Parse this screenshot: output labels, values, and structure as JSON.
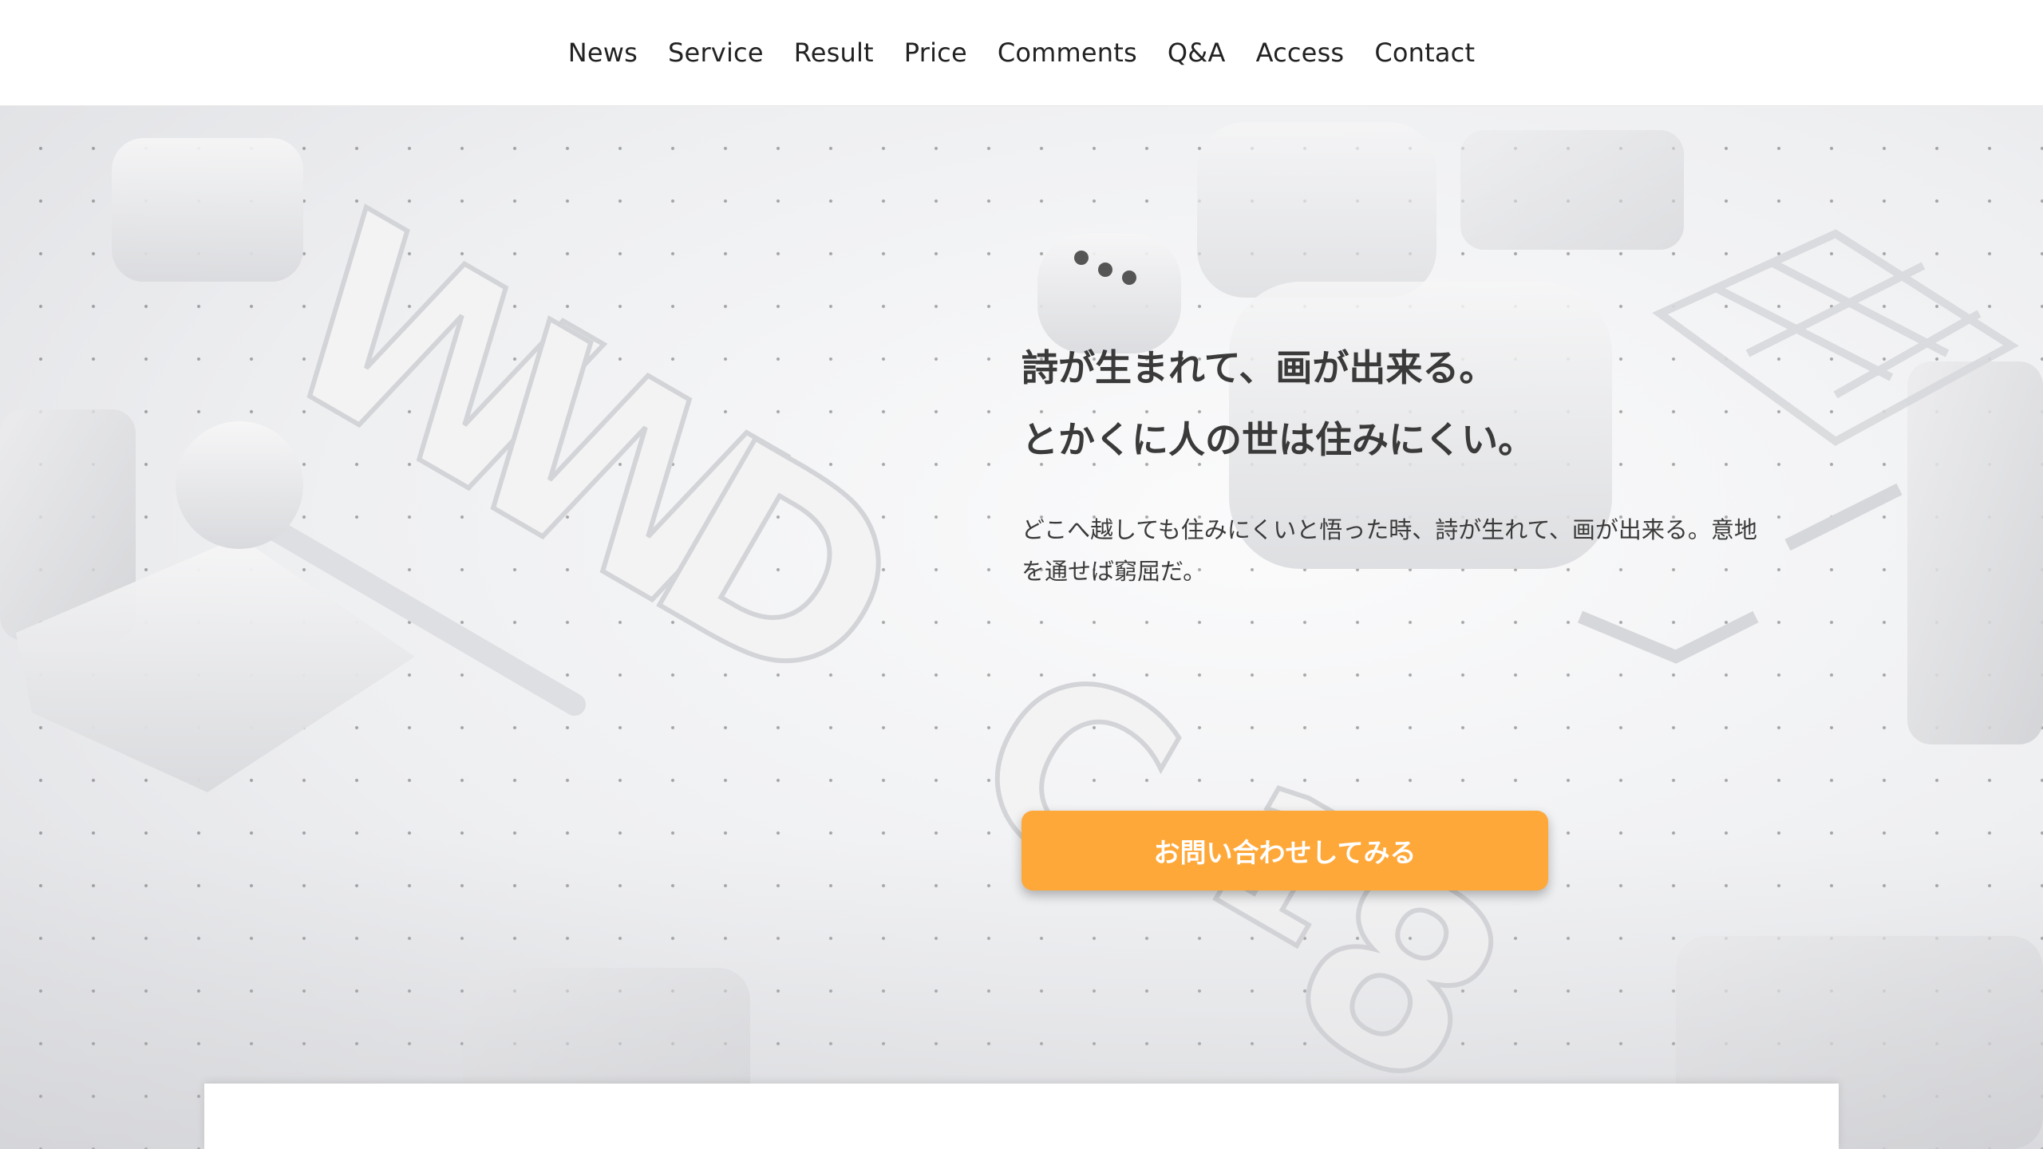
{
  "nav": {
    "items": [
      {
        "label": "News"
      },
      {
        "label": "Service"
      },
      {
        "label": "Result"
      },
      {
        "label": "Price"
      },
      {
        "label": "Comments"
      },
      {
        "label": "Q&A"
      },
      {
        "label": "Access"
      },
      {
        "label": "Contact"
      }
    ]
  },
  "hero": {
    "heading_line1": "詩が生まれて、画が出来る。",
    "heading_line2": "とかくに人の世は住みにくい。",
    "text": "どこへ越しても住みにくいと悟った時、詩が生れて、画が出来る。意地を通せば窮屈だ。",
    "cta_label": "お問い合わせしてみる",
    "background_letters": "WWDC 18"
  },
  "colors": {
    "cta": "#ffa83a",
    "header_bg": "#ffffff",
    "text": "#3a3a3a"
  }
}
